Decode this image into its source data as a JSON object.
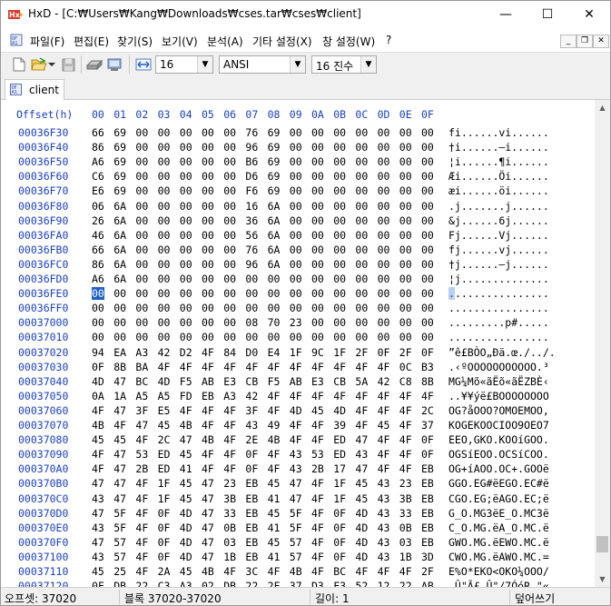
{
  "window": {
    "app_icon": "hxd-logo-icon",
    "title": "HxD - [C:₩Users₩Kang₩Downloads₩cses.tar₩cses₩client]",
    "controls": {
      "minimize": "—",
      "maximize": "☐",
      "close": "✕"
    }
  },
  "menu": {
    "items": [
      "파일(F)",
      "편집(E)",
      "찾기(S)",
      "보기(V)",
      "분석(A)",
      "기타 설정(X)",
      "창 설정(W)",
      "?"
    ],
    "mdi": {
      "minimize": "_",
      "restore": "❐",
      "close": "✕"
    }
  },
  "toolbar": {
    "icons": [
      "new-file-icon",
      "open-folder-icon",
      "dropdown-arrow-icon",
      "save-disk-icon",
      "open-disk-icon",
      "open-ram-icon",
      "bytes-per-row-icon"
    ],
    "bytes_per_row": "16",
    "charset": "ANSI",
    "offset_base": "16 진수"
  },
  "tabs": [
    {
      "label": "client",
      "icon": "document-icon"
    }
  ],
  "editor": {
    "header_offset": "Offset(h)",
    "columns": [
      "00",
      "01",
      "02",
      "03",
      "04",
      "05",
      "06",
      "07",
      "08",
      "09",
      "0A",
      "0B",
      "0C",
      "0D",
      "0E",
      "0F"
    ],
    "selected": {
      "row": 11,
      "col": 0
    },
    "rows": [
      {
        "offset": "00036F30",
        "bytes": [
          "66",
          "69",
          "00",
          "00",
          "00",
          "00",
          "00",
          "76",
          "69",
          "00",
          "00",
          "00",
          "00",
          "00",
          "00",
          "00"
        ],
        "ascii": "fi......vi......"
      },
      {
        "offset": "00036F40",
        "bytes": [
          "86",
          "69",
          "00",
          "00",
          "00",
          "00",
          "00",
          "96",
          "69",
          "00",
          "00",
          "00",
          "00",
          "00",
          "00",
          "00"
        ],
        "ascii": "†i......–i......"
      },
      {
        "offset": "00036F50",
        "bytes": [
          "A6",
          "69",
          "00",
          "00",
          "00",
          "00",
          "00",
          "B6",
          "69",
          "00",
          "00",
          "00",
          "00",
          "00",
          "00",
          "00"
        ],
        "ascii": "¦i......¶i......"
      },
      {
        "offset": "00036F60",
        "bytes": [
          "C6",
          "69",
          "00",
          "00",
          "00",
          "00",
          "00",
          "D6",
          "69",
          "00",
          "00",
          "00",
          "00",
          "00",
          "00",
          "00"
        ],
        "ascii": "Æi......Öi......"
      },
      {
        "offset": "00036F70",
        "bytes": [
          "E6",
          "69",
          "00",
          "00",
          "00",
          "00",
          "00",
          "F6",
          "69",
          "00",
          "00",
          "00",
          "00",
          "00",
          "00",
          "00"
        ],
        "ascii": "æi......öi......"
      },
      {
        "offset": "00036F80",
        "bytes": [
          "06",
          "6A",
          "00",
          "00",
          "00",
          "00",
          "00",
          "16",
          "6A",
          "00",
          "00",
          "00",
          "00",
          "00",
          "00",
          "00"
        ],
        "ascii": ".j.......j......"
      },
      {
        "offset": "00036F90",
        "bytes": [
          "26",
          "6A",
          "00",
          "00",
          "00",
          "00",
          "00",
          "36",
          "6A",
          "00",
          "00",
          "00",
          "00",
          "00",
          "00",
          "00"
        ],
        "ascii": "&j......6j......"
      },
      {
        "offset": "00036FA0",
        "bytes": [
          "46",
          "6A",
          "00",
          "00",
          "00",
          "00",
          "00",
          "56",
          "6A",
          "00",
          "00",
          "00",
          "00",
          "00",
          "00",
          "00"
        ],
        "ascii": "Fj......Vj......"
      },
      {
        "offset": "00036FB0",
        "bytes": [
          "66",
          "6A",
          "00",
          "00",
          "00",
          "00",
          "00",
          "76",
          "6A",
          "00",
          "00",
          "00",
          "00",
          "00",
          "00",
          "00"
        ],
        "ascii": "fj......vj......"
      },
      {
        "offset": "00036FC0",
        "bytes": [
          "86",
          "6A",
          "00",
          "00",
          "00",
          "00",
          "00",
          "96",
          "6A",
          "00",
          "00",
          "00",
          "00",
          "00",
          "00",
          "00"
        ],
        "ascii": "†j......–j......"
      },
      {
        "offset": "00036FD0",
        "bytes": [
          "A6",
          "6A",
          "00",
          "00",
          "00",
          "00",
          "00",
          "00",
          "00",
          "00",
          "00",
          "00",
          "00",
          "00",
          "00",
          "00"
        ],
        "ascii": "¦j.............."
      },
      {
        "offset": "00036FE0",
        "bytes": [
          "00",
          "00",
          "00",
          "00",
          "00",
          "00",
          "00",
          "00",
          "00",
          "00",
          "00",
          "00",
          "00",
          "00",
          "00",
          "00"
        ],
        "ascii": "................"
      },
      {
        "offset": "00036FF0",
        "bytes": [
          "00",
          "00",
          "00",
          "00",
          "00",
          "00",
          "00",
          "00",
          "00",
          "00",
          "00",
          "00",
          "00",
          "00",
          "00",
          "00"
        ],
        "ascii": "................"
      },
      {
        "offset": "00037000",
        "bytes": [
          "00",
          "00",
          "00",
          "00",
          "00",
          "00",
          "00",
          "08",
          "70",
          "23",
          "00",
          "00",
          "00",
          "00",
          "00",
          "00"
        ],
        "ascii": ".........p#....."
      },
      {
        "offset": "00037010",
        "bytes": [
          "00",
          "00",
          "00",
          "00",
          "00",
          "00",
          "00",
          "00",
          "00",
          "00",
          "00",
          "00",
          "00",
          "00",
          "00",
          "00"
        ],
        "ascii": "................"
      },
      {
        "offset": "00037020",
        "bytes": [
          "94",
          "EA",
          "A3",
          "42",
          "D2",
          "4F",
          "84",
          "D0",
          "E4",
          "1F",
          "9C",
          "1F",
          "2F",
          "0F",
          "2F",
          "0F"
        ],
        "ascii": "”ê£BÒO„Ðä.œ./../."
      },
      {
        "offset": "00037030",
        "bytes": [
          "0F",
          "8B",
          "BA",
          "4F",
          "4F",
          "4F",
          "4F",
          "4F",
          "4F",
          "4F",
          "4F",
          "4F",
          "4F",
          "4F",
          "0C",
          "B3"
        ],
        "ascii": ".‹ºOOOOOOOOOOO.³"
      },
      {
        "offset": "00037040",
        "bytes": [
          "4D",
          "47",
          "BC",
          "4D",
          "F5",
          "AB",
          "E3",
          "CB",
          "F5",
          "AB",
          "E3",
          "CB",
          "5A",
          "42",
          "C8",
          "8B"
        ],
        "ascii": "MG¼Mõ«ãËõ«ãËZBÈ‹"
      },
      {
        "offset": "00037050",
        "bytes": [
          "0A",
          "1A",
          "A5",
          "A5",
          "FD",
          "EB",
          "A3",
          "42",
          "4F",
          "4F",
          "4F",
          "4F",
          "4F",
          "4F",
          "4F",
          "4F"
        ],
        "ascii": "..¥¥ýë£BOOOOOOOO"
      },
      {
        "offset": "00037060",
        "bytes": [
          "4F",
          "47",
          "3F",
          "E5",
          "4F",
          "4F",
          "4F",
          "3F",
          "4F",
          "4D",
          "45",
          "4D",
          "4F",
          "4F",
          "4F",
          "2C"
        ],
        "ascii": "OG?åOOO?OMOEMOO,"
      },
      {
        "offset": "00037070",
        "bytes": [
          "4B",
          "4F",
          "47",
          "45",
          "4B",
          "4F",
          "4F",
          "43",
          "49",
          "4F",
          "4F",
          "39",
          "4F",
          "45",
          "4F",
          "37"
        ],
        "ascii": "KOGEKOOCIOO9OEO7"
      },
      {
        "offset": "00037080",
        "bytes": [
          "45",
          "45",
          "4F",
          "2C",
          "47",
          "4B",
          "4F",
          "2E",
          "4B",
          "4F",
          "4F",
          "ED",
          "47",
          "4F",
          "4F",
          "0F"
        ],
        "ascii": "EEO,GKO.KOOíGOO."
      },
      {
        "offset": "00037090",
        "bytes": [
          "4F",
          "47",
          "53",
          "ED",
          "45",
          "4F",
          "4F",
          "0F",
          "4F",
          "43",
          "53",
          "ED",
          "43",
          "4F",
          "4F",
          "0F"
        ],
        "ascii": "OGSíEOO.OCSíCOO."
      },
      {
        "offset": "000370A0",
        "bytes": [
          "4F",
          "47",
          "2B",
          "ED",
          "41",
          "4F",
          "4F",
          "0F",
          "4F",
          "43",
          "2B",
          "17",
          "47",
          "4F",
          "4F",
          "EB"
        ],
        "ascii": "OG+íAOO.OC+.GOOë"
      },
      {
        "offset": "000370B0",
        "bytes": [
          "47",
          "47",
          "4F",
          "1F",
          "45",
          "47",
          "23",
          "EB",
          "45",
          "47",
          "4F",
          "1F",
          "45",
          "43",
          "23",
          "EB"
        ],
        "ascii": "GGO.EG#ëEGO.EC#ë"
      },
      {
        "offset": "000370C0",
        "bytes": [
          "43",
          "47",
          "4F",
          "1F",
          "45",
          "47",
          "3B",
          "EB",
          "41",
          "47",
          "4F",
          "1F",
          "45",
          "43",
          "3B",
          "EB"
        ],
        "ascii": "CGO.EG;ëAGO.EC;ë"
      },
      {
        "offset": "000370D0",
        "bytes": [
          "47",
          "5F",
          "4F",
          "0F",
          "4D",
          "47",
          "33",
          "EB",
          "45",
          "5F",
          "4F",
          "0F",
          "4D",
          "43",
          "33",
          "EB"
        ],
        "ascii": "G_O.MG3ëE_O.MC3ë"
      },
      {
        "offset": "000370E0",
        "bytes": [
          "43",
          "5F",
          "4F",
          "0F",
          "4D",
          "47",
          "0B",
          "EB",
          "41",
          "5F",
          "4F",
          "0F",
          "4D",
          "43",
          "0B",
          "EB"
        ],
        "ascii": "C_O.MG.ëA_O.MC.ë"
      },
      {
        "offset": "000370F0",
        "bytes": [
          "47",
          "57",
          "4F",
          "0F",
          "4D",
          "47",
          "03",
          "EB",
          "45",
          "57",
          "4F",
          "0F",
          "4D",
          "43",
          "03",
          "EB"
        ],
        "ascii": "GWO.MG.ëEWO.MC.ë"
      },
      {
        "offset": "00037100",
        "bytes": [
          "43",
          "57",
          "4F",
          "0F",
          "4D",
          "47",
          "1B",
          "EB",
          "41",
          "57",
          "4F",
          "0F",
          "4D",
          "43",
          "1B",
          "3D"
        ],
        "ascii": "CWO.MG.ëAWO.MC.="
      },
      {
        "offset": "00037110",
        "bytes": [
          "45",
          "25",
          "4F",
          "2A",
          "45",
          "4B",
          "4F",
          "3C",
          "4F",
          "4B",
          "4F",
          "BC",
          "4F",
          "4F",
          "4F",
          "2F"
        ],
        "ascii": "E%O*EKO<OKO¼OOO/"
      },
      {
        "offset": "00037120",
        "bytes": [
          "0F",
          "DB",
          "22",
          "C3",
          "A3",
          "02",
          "DB",
          "22",
          "2F",
          "37",
          "D3",
          "F3",
          "52",
          "12",
          "22",
          "AB"
        ],
        "ascii": ".Û\"Ã£.Û\"/7ÓóR.\"«"
      }
    ]
  },
  "scrollbar": {
    "up": "▲",
    "down": "▼"
  },
  "status": {
    "offset": "오프셋: 37020",
    "block": "블록 37020-37020",
    "length": "길이: 1",
    "mode": "덮어쓰기"
  }
}
